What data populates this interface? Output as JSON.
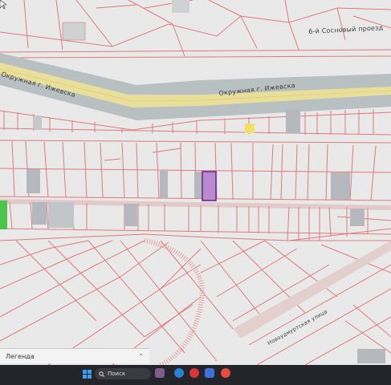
{
  "map": {
    "labels": {
      "ring_road_west": "Окружная г. Ижевска",
      "ring_road_east": "Окружная г. Ижевска",
      "street_north": "6-й Сосновый проезд",
      "street_south": "Новоудмуртская улица"
    },
    "colors": {
      "background": "#e9e9ea",
      "road_fill": "#b8c0c2",
      "road_center": "#e9df9a",
      "parcel_line": "#e07a7a",
      "selected_parcel_fill": "#b98ad0",
      "selected_parcel_border": "#6a2b8c",
      "building_fill": "#b5b8bd",
      "highlight_yellow": "#f2e06a",
      "green_patch": "#4cc34a"
    }
  },
  "legend": {
    "label": "Легенда",
    "toggle_icon": "chevron-up-down-icon",
    "toggle_glyph": "⌃"
  },
  "taskbar": {
    "search_placeholder": "Поиск",
    "apps": [
      "start-icon",
      "search-icon",
      "media-icon",
      "edge-icon",
      "opera-icon",
      "chat-icon",
      "teams-icon",
      "yandex-icon"
    ]
  }
}
